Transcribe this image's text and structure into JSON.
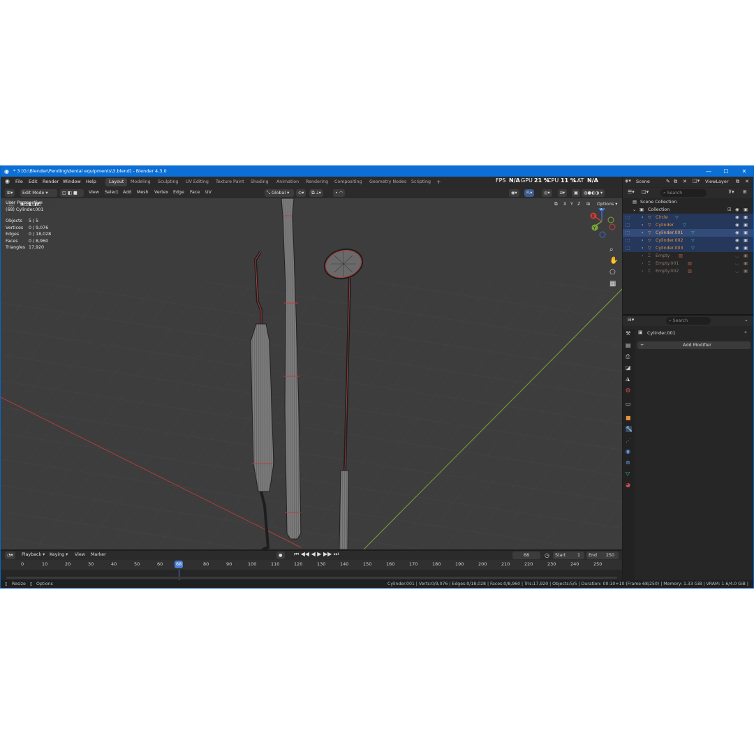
{
  "titlebar": {
    "title": "* 3 [G:\\Blender\\Pending\\dental equipments\\3.blend] - Blender 4.3.0",
    "minimize": "—",
    "maximize": "☐",
    "close": "✕"
  },
  "menu": {
    "items": [
      "File",
      "Edit",
      "Render",
      "Window",
      "Help"
    ],
    "workspaces": [
      "Layout",
      "Modeling",
      "Sculpting",
      "UV Editing",
      "Texture Paint",
      "Shading",
      "Animation",
      "Rendering",
      "Compositing",
      "Geometry Nodes",
      "Scripting"
    ],
    "active_workspace": "Layout",
    "add_tab": "+"
  },
  "perf": {
    "fps_label": "FPS",
    "fps_value": "N/A",
    "gpu_label": "GPU",
    "gpu_value": "21 %",
    "cpu_label": "CPU",
    "cpu_value": "11 %",
    "lat_label": "LAT",
    "lat_value": "N/A"
  },
  "viewport_header": {
    "mode": "Edit Mode",
    "menus": [
      "View",
      "Select",
      "Add",
      "Mesh",
      "Vertex",
      "Edge",
      "Face",
      "UV"
    ],
    "transform_orientation": "Global",
    "options": "Options",
    "axes": [
      "X",
      "Y",
      "Z"
    ]
  },
  "overlay": {
    "perspective": "User Perspective",
    "object": "(68) Cylinder.001",
    "stats": [
      {
        "label": "Objects",
        "value": "5 / 5"
      },
      {
        "label": "Vertices",
        "value": "0 / 9,076"
      },
      {
        "label": "Edges",
        "value": "0 / 18,028"
      },
      {
        "label": "Faces",
        "value": "0 / 8,960"
      },
      {
        "label": "Triangles",
        "value": "17,920"
      }
    ]
  },
  "gizmo": {
    "x": "X",
    "y": "Y",
    "z": "Z"
  },
  "timeline": {
    "menus": [
      "Playback",
      "Keying",
      "View",
      "Marker"
    ],
    "current_frame": "68",
    "start_label": "Start",
    "start": "1",
    "end_label": "End",
    "end": "250",
    "ticks": [
      "0",
      "10",
      "20",
      "30",
      "40",
      "50",
      "60",
      "80",
      "90",
      "100",
      "110",
      "120",
      "130",
      "140",
      "150",
      "160",
      "170",
      "180",
      "190",
      "200",
      "210",
      "220",
      "230",
      "240",
      "250"
    ]
  },
  "statusbar": {
    "resize": "Resize",
    "options": "Options",
    "info": "Cylinder.001 | Verts:0/9,076 | Edges:0/18,028 | Faces:0/8,960 | Tris:17,920 | Objects:5/5 | Duration: 00:10+10 (Frame 68/250) | Memory: 1.33 GiB | VRAM: 1.6/4.0 GiB | 4.3.0"
  },
  "top_right": {
    "scene": "Scene",
    "view_layer": "ViewLayer"
  },
  "outliner": {
    "search_placeholder": "Search",
    "scene_collection": "Scene Collection",
    "collection": "Collection",
    "items": [
      {
        "name": "Circle",
        "selected": true,
        "active": false,
        "kind": "mesh"
      },
      {
        "name": "Cylinder",
        "selected": true,
        "active": false,
        "kind": "mesh"
      },
      {
        "name": "Cylinder.001",
        "selected": true,
        "active": true,
        "kind": "mesh"
      },
      {
        "name": "Cylinder.002",
        "selected": true,
        "active": false,
        "kind": "mesh"
      },
      {
        "name": "Cylinder.003",
        "selected": true,
        "active": false,
        "kind": "mesh"
      },
      {
        "name": "Empty",
        "selected": false,
        "active": false,
        "kind": "empty"
      },
      {
        "name": "Empty.001",
        "selected": false,
        "active": false,
        "kind": "empty"
      },
      {
        "name": "Empty.002",
        "selected": false,
        "active": false,
        "kind": "empty"
      }
    ]
  },
  "properties": {
    "search_placeholder": "Search",
    "object_name": "Cylinder.001",
    "add_modifier": "Add Modifier"
  },
  "colors": {
    "titlebar": "#0b6fd6",
    "viewport_bg": "#3d3d3d",
    "selection": "#25375a",
    "active_frame": "#4a7fd4",
    "x_axis": "#c94040",
    "y_axis": "#7fa33a"
  }
}
